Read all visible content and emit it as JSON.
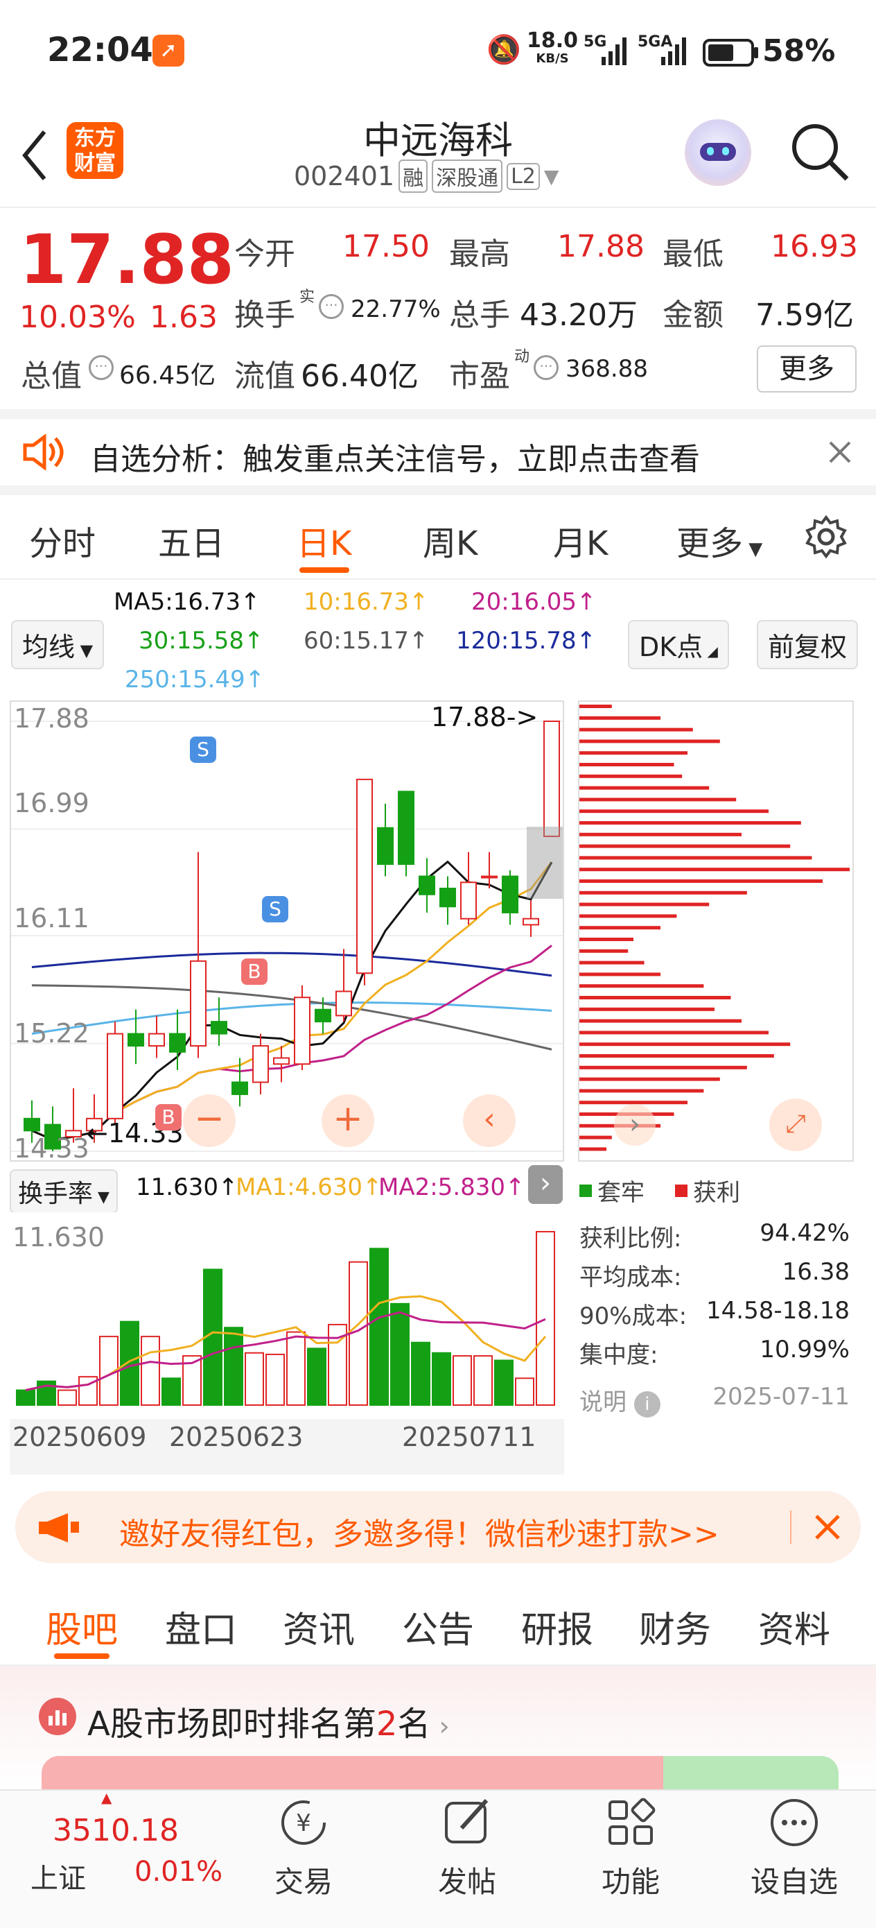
{
  "status_bar": {
    "time": "22:04",
    "net_speed": "18.0",
    "net_unit": "KB/S",
    "sig1": "5G",
    "sig2": "5GA",
    "battery": "58%"
  },
  "header": {
    "title": "中远海科",
    "code": "002401",
    "tag1": "融",
    "tag2": "深股通",
    "tag3": "L2",
    "logo_line1": "东方",
    "logo_line2": "财富"
  },
  "quote": {
    "price": "17.88",
    "pct": "10.03%",
    "change": "1.63",
    "open_label": "今开",
    "open": "17.50",
    "high_label": "最高",
    "high": "17.88",
    "low_label": "最低",
    "low": "16.93",
    "turnover_label": "换手",
    "turnover_sup": "实",
    "turnover": "22.77%",
    "volume_label": "总手",
    "volume": "43.20万",
    "amount_label": "金额",
    "amount": "7.59亿",
    "mktcap_label": "总值",
    "mktcap": "66.45亿",
    "float_label": "流值",
    "float": "66.40亿",
    "pe_label": "市盈",
    "pe_sup": "动",
    "pe": "368.88",
    "more_btn": "更多"
  },
  "banner": {
    "text": "自选分析：触发重点关注信号，立即点击查看"
  },
  "tabs": [
    "分时",
    "五日",
    "日K",
    "周K",
    "月K",
    "更多"
  ],
  "active_tab": "日K",
  "ma_bar": {
    "ma5": "MA5:16.73↑",
    "ma10": "10:16.73↑",
    "ma20": "20:16.05↑",
    "ma30": "30:15.58↑",
    "ma60": "60:15.17↑",
    "ma120": "120:15.78↑",
    "ma250": "250:15.49↑",
    "selector": "均线",
    "dk": "DK点",
    "adjust": "前复权"
  },
  "colors": {
    "up": "#e02424",
    "down": "#14a014",
    "ma5": "#111111",
    "ma10": "#f0b020",
    "ma20": "#c0208a",
    "ma30": "#18a018",
    "ma60": "#666666",
    "ma120": "#1a2a9a",
    "ma250": "#5ab4e8",
    "accent": "#ff5a00"
  },
  "chart_data": {
    "type": "candlestick",
    "y_ticks": [
      "17.88",
      "16.99",
      "16.11",
      "15.22",
      "14.33"
    ],
    "ylim": [
      14.33,
      17.88
    ],
    "last_price_label": "17.88->",
    "low_label": "14.33",
    "markers": [
      "S",
      "S",
      "B",
      "B"
    ],
    "candles": [
      {
        "o": 14.6,
        "c": 14.5,
        "h": 14.75,
        "l": 14.4
      },
      {
        "o": 14.55,
        "c": 14.35,
        "h": 14.7,
        "l": 14.33
      },
      {
        "o": 14.45,
        "c": 14.5,
        "h": 14.85,
        "l": 14.4
      },
      {
        "o": 14.5,
        "c": 14.6,
        "h": 14.8,
        "l": 14.4
      },
      {
        "o": 14.6,
        "c": 15.3,
        "h": 15.4,
        "l": 14.55
      },
      {
        "o": 15.3,
        "c": 15.2,
        "h": 15.5,
        "l": 15.05
      },
      {
        "o": 15.2,
        "c": 15.3,
        "h": 15.45,
        "l": 15.1
      },
      {
        "o": 15.3,
        "c": 15.15,
        "h": 15.5,
        "l": 15.0
      },
      {
        "o": 15.2,
        "c": 15.9,
        "h": 16.8,
        "l": 15.1
      },
      {
        "o": 15.4,
        "c": 15.3,
        "h": 15.6,
        "l": 15.2
      },
      {
        "o": 14.9,
        "c": 14.8,
        "h": 15.1,
        "l": 14.7
      },
      {
        "o": 14.9,
        "c": 15.2,
        "h": 15.3,
        "l": 14.8
      },
      {
        "o": 15.05,
        "c": 15.1,
        "h": 15.2,
        "l": 14.9
      },
      {
        "o": 15.05,
        "c": 15.6,
        "h": 15.7,
        "l": 15.0
      },
      {
        "o": 15.5,
        "c": 15.4,
        "h": 15.6,
        "l": 15.3
      },
      {
        "o": 15.45,
        "c": 15.65,
        "h": 16.0,
        "l": 15.4
      },
      {
        "o": 15.8,
        "c": 17.4,
        "h": 17.4,
        "l": 15.7
      },
      {
        "o": 17.0,
        "c": 16.7,
        "h": 17.2,
        "l": 16.6
      },
      {
        "o": 17.3,
        "c": 16.7,
        "h": 17.3,
        "l": 16.6
      },
      {
        "o": 16.6,
        "c": 16.45,
        "h": 16.75,
        "l": 16.3
      },
      {
        "o": 16.5,
        "c": 16.35,
        "h": 16.6,
        "l": 16.2
      },
      {
        "o": 16.25,
        "c": 16.55,
        "h": 16.8,
        "l": 16.2
      },
      {
        "o": 16.6,
        "c": 16.6,
        "h": 16.8,
        "l": 16.5
      },
      {
        "o": 16.6,
        "c": 16.3,
        "h": 16.65,
        "l": 16.2
      },
      {
        "o": 16.2,
        "c": 16.25,
        "h": 16.4,
        "l": 16.1
      },
      {
        "o": 16.93,
        "c": 17.88,
        "h": 17.88,
        "l": 16.93
      }
    ],
    "volume_label": "换手率",
    "volume_value": "11.630↑",
    "vol_ma1": "MA1:4.630↑",
    "vol_ma2": "MA2:5.830↑",
    "volume_top": "11.630",
    "volumes": [
      1.0,
      1.6,
      1.0,
      1.9,
      4.6,
      5.6,
      4.6,
      1.8,
      3.3,
      9.1,
      5.2,
      3.5,
      3.4,
      4.9,
      3.8,
      5.4,
      9.6,
      10.5,
      6.8,
      4.2,
      3.5,
      3.3,
      3.3,
      3.0,
      1.8,
      11.63
    ],
    "x_labels": [
      "20250609",
      "20250623",
      "20250711"
    ]
  },
  "distribution": {
    "legend_trapped": "套牢",
    "legend_profit": "获利",
    "profit_ratio_label": "获利比例:",
    "profit_ratio": "94.42%",
    "avg_cost_label": "平均成本:",
    "avg_cost": "16.38",
    "cost90_label": "90%成本:",
    "cost90": "14.58-18.18",
    "concentration_label": "集中度:",
    "concentration": "10.99%",
    "note_label": "说明",
    "date": "2025-07-11",
    "bars": [
      0.12,
      0.3,
      0.42,
      0.52,
      0.4,
      0.35,
      0.38,
      0.48,
      0.58,
      0.7,
      0.82,
      0.6,
      0.78,
      0.86,
      1.0,
      0.9,
      0.62,
      0.48,
      0.36,
      0.3,
      0.2,
      0.18,
      0.24,
      0.3,
      0.46,
      0.56,
      0.5,
      0.6,
      0.7,
      0.78,
      0.72,
      0.62,
      0.52,
      0.46,
      0.4,
      0.35,
      0.3,
      0.12,
      0.1
    ]
  },
  "invite": {
    "text": "邀好友得红包，多邀多得！微信秒速打款>>"
  },
  "bottom_tabs": [
    "股吧",
    "盘口",
    "资讯",
    "公告",
    "研报",
    "财务",
    "资料"
  ],
  "rank": {
    "prefix": "A股市场即时排名第",
    "num": "2",
    "suffix": "名"
  },
  "bottom_bar": {
    "index_value": "3510.18",
    "index_name": "上证",
    "index_pct": "0.01%",
    "trade": "交易",
    "post": "发帖",
    "func": "功能",
    "watch": "设自选"
  }
}
